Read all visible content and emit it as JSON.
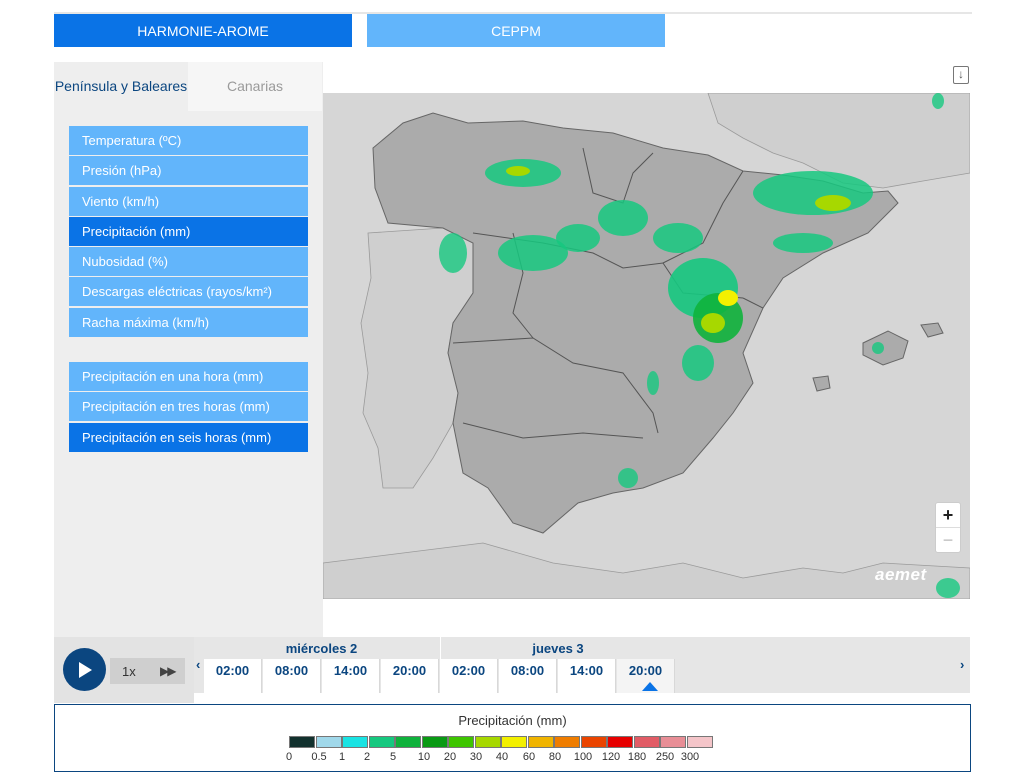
{
  "model_tabs": {
    "active": "HARMONIE-AROME",
    "inactive": "CEPPM"
  },
  "region_tabs": {
    "active": "Península y Baleares",
    "inactive": "Canarias"
  },
  "variables": [
    "Temperatura (ºC)",
    "Presión (hPa)",
    "Viento (km/h)",
    "Precipitación (mm)",
    "Nubosidad (%)",
    "Descargas eléctricas (rayos/km²)",
    "Racha máxima (km/h)"
  ],
  "selected_variable": "Precipitación (mm)",
  "accum_variables": [
    "Precipitación en una hora (mm)",
    "Precipitación en tres horas (mm)",
    "Precipitación en seis horas (mm)"
  ],
  "selected_accum": "Precipitación en seis horas (mm)",
  "map": {
    "logo": "aemet",
    "zoom_in": "+",
    "zoom_out": "−"
  },
  "player": {
    "speed": "1x",
    "ff": "▶▶"
  },
  "timeline": {
    "days": [
      "miércoles 2",
      "jueves 3"
    ],
    "hours": [
      "02:00",
      "08:00",
      "14:00",
      "20:00",
      "02:00",
      "08:00",
      "14:00",
      "20:00"
    ],
    "current_index": 7,
    "prev": "‹",
    "next": "›"
  },
  "legend": {
    "title": "Precipitación (mm)",
    "colors": [
      "#12312e",
      "#a0d8ea",
      "#1ae3e3",
      "#16c87f",
      "#0fb23c",
      "#0a9a14",
      "#3ec500",
      "#a7d800",
      "#f3f000",
      "#f0b400",
      "#ef7d00",
      "#ea4400",
      "#e60000",
      "#e15c66",
      "#e88e96",
      "#f4c5c9"
    ],
    "labels": [
      "0",
      "0.5",
      "1",
      "2",
      "5",
      "10",
      "20",
      "30",
      "40",
      "60",
      "80",
      "100",
      "120",
      "180",
      "250",
      "300"
    ]
  }
}
